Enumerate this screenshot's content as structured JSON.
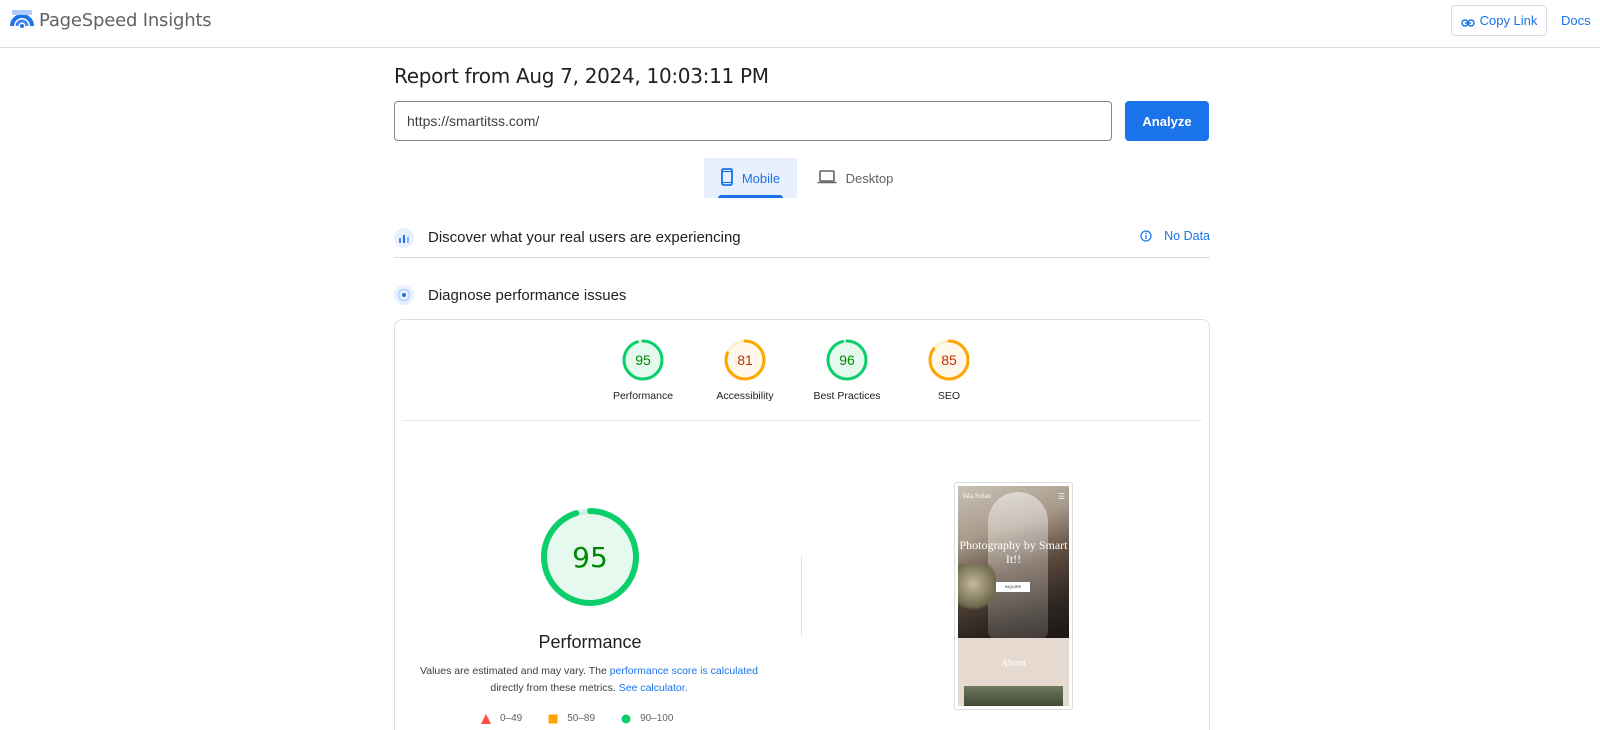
{
  "header": {
    "app_title": "PageSpeed Insights",
    "copy_link_label": "Copy Link",
    "docs_label": "Docs"
  },
  "report": {
    "title": "Report from Aug 7, 2024, 10:03:11 PM",
    "url_value": "https://smartitss.com/",
    "analyze_label": "Analyze"
  },
  "device_tabs": [
    {
      "label": "Mobile",
      "selected": true,
      "icon": "smartphone-icon"
    },
    {
      "label": "Desktop",
      "selected": false,
      "icon": "laptop-icon"
    }
  ],
  "sections": {
    "discover_label": "Discover what your real users are experiencing",
    "no_data_label": "No Data",
    "diagnose_label": "Diagnose performance issues"
  },
  "scores": [
    {
      "label": "Performance",
      "value": "95",
      "status": "pass"
    },
    {
      "label": "Accessibility",
      "value": "81",
      "status": "average"
    },
    {
      "label": "Best Practices",
      "value": "96",
      "status": "pass"
    },
    {
      "label": "SEO",
      "value": "85",
      "status": "average"
    }
  ],
  "main_score": {
    "value": "95",
    "label": "Performance",
    "estimate_prefix": "Values are estimated and may vary. The ",
    "estimate_link1": "performance score is calculated",
    "estimate_middle": " directly from these metrics. ",
    "estimate_link2": "See calculator."
  },
  "legend": [
    {
      "range": "0–49",
      "shape": "triangle",
      "color": "#ff4e42"
    },
    {
      "range": "50–89",
      "shape": "square",
      "color": "#ffa400"
    },
    {
      "range": "90–100",
      "shape": "circle",
      "color": "#0cce6b"
    }
  ],
  "screenshot": {
    "brand": "Isla Solan",
    "menu_icon": "☰",
    "headline": "Photography by Smart It!!",
    "button_label": "INQUIRE",
    "about_label": "About"
  },
  "colors": {
    "accent": "#1a73e8",
    "pass": "#0cce6b",
    "pass_text": "#008800",
    "average": "#ffa400",
    "average_text": "#c33300",
    "fail": "#ff4e42"
  }
}
